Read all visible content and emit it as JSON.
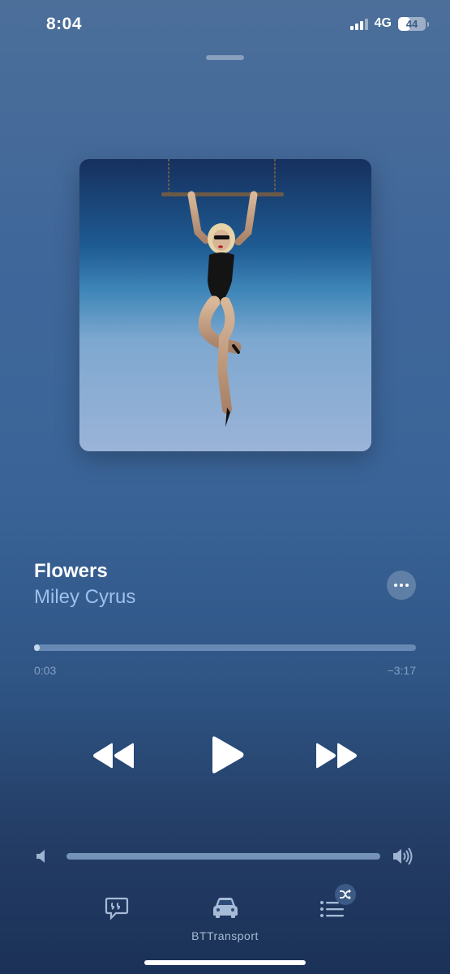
{
  "status": {
    "time": "8:04",
    "network": "4G",
    "battery": "44",
    "battery_level": 0.44
  },
  "track": {
    "title": "Flowers",
    "artist": "Miley Cyrus"
  },
  "playback": {
    "elapsed": "0:03",
    "remaining": "−3:17",
    "progress": 0.015
  },
  "volume": {
    "level": 1.0
  },
  "bottom": {
    "output_device": "BTTransport"
  },
  "colors": {
    "background_top": "#4c6f9a",
    "background_bottom": "#1b3157",
    "artist_text": "#9ec0ec",
    "accent": "#ffffff"
  },
  "icons": {
    "more": "ellipsis-icon",
    "rewind": "rewind-icon",
    "play": "play-icon",
    "forward": "fast-forward-icon",
    "volume_low": "speaker-low-icon",
    "volume_high": "speaker-high-icon",
    "lyrics": "lyrics-quote-icon",
    "airplay": "car-icon",
    "queue": "list-icon",
    "shuffle": "shuffle-icon"
  }
}
